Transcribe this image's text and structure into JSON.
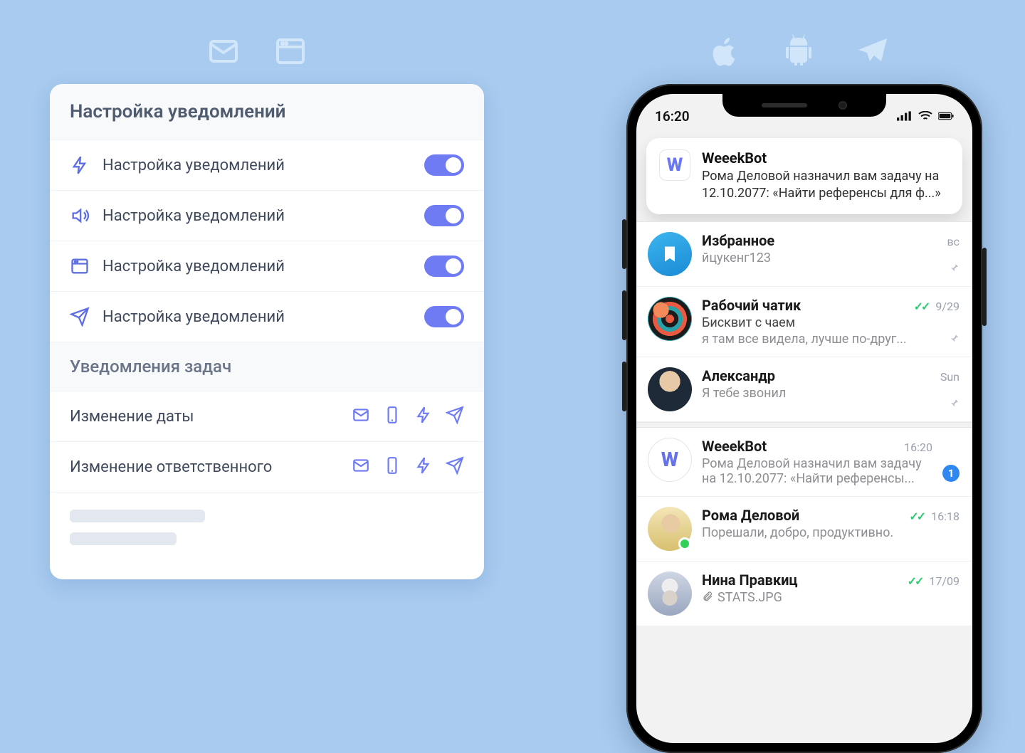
{
  "topIcons": {
    "left": [
      "mail-icon",
      "browser-icon"
    ],
    "right": [
      "apple-icon",
      "android-icon",
      "telegram-icon"
    ]
  },
  "settings": {
    "header": "Настройка уведомлений",
    "channels": [
      {
        "icon": "bolt-icon",
        "label": "Настройка уведомлений",
        "enabled": true
      },
      {
        "icon": "speaker-icon",
        "label": "Настройка уведомлений",
        "enabled": true
      },
      {
        "icon": "browser-icon",
        "label": "Настройка уведомлений",
        "enabled": true
      },
      {
        "icon": "send-icon",
        "label": "Настройка уведомлений",
        "enabled": true
      }
    ],
    "tasksHeader": "Уведомления задач",
    "taskRows": [
      {
        "label": "Изменение даты",
        "channels": [
          "mail",
          "mobile",
          "bolt",
          "send"
        ]
      },
      {
        "label": "Изменение ответственного",
        "channels": [
          "mail",
          "mobile",
          "bolt",
          "send"
        ]
      }
    ]
  },
  "phone": {
    "statusTime": "16:20",
    "push": {
      "appIconLetter": "W",
      "title": "WeeekBot",
      "body": "Рома Деловой назначил вам задачу на 12.10.2077: «Найти референсы для ф...»"
    },
    "chats": [
      {
        "avatar": "saved",
        "avatarGlyph": "🔖",
        "name": "Избранное",
        "time": "вс",
        "sub": "",
        "preview": "йцукенг123",
        "pinned": true
      },
      {
        "avatar": "img1",
        "name": "Рабочий чатик",
        "checks": true,
        "time": "9/29",
        "sub": "Бисквит с чаем",
        "preview": "я там все видела, лучше по-друг...",
        "pinned": true
      },
      {
        "avatar": "img2",
        "name": "Александр",
        "time": "Sun",
        "sub": "",
        "preview": "Я тебе звонил",
        "pinned": true
      },
      {
        "avatar": "wbot",
        "avatarGlyph": "W",
        "name": "WeeekBot",
        "time": "16:20",
        "sub": "",
        "preview": "Рома Деловой назначил вам задачу на 12.10.2077: «Найти референсы...",
        "unread": 1
      },
      {
        "avatar": "img3",
        "presence": true,
        "name": "Рома Деловой",
        "checks": true,
        "time": "16:18",
        "sub": "",
        "preview": "Порешали, добро, продуктивно."
      },
      {
        "avatar": "img4",
        "name": "Нина Правкиц",
        "checks": true,
        "time": "17/09",
        "sub": "",
        "preview": "STATS.JPG",
        "attachment": true
      }
    ]
  }
}
